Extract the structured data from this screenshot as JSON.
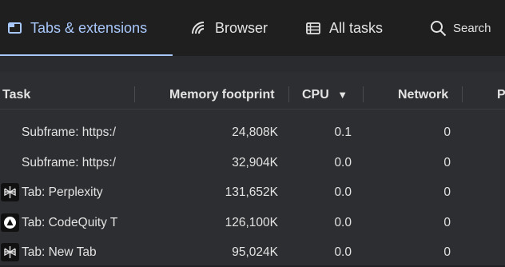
{
  "tabs": [
    {
      "label": "Tabs & extensions",
      "icon": "tabs-icon",
      "active": true
    },
    {
      "label": "Browser",
      "icon": "browser-icon",
      "active": false
    },
    {
      "label": "All tasks",
      "icon": "list-icon",
      "active": false
    }
  ],
  "search": {
    "label": "Search",
    "icon": "search-icon"
  },
  "columns": {
    "task": "Task",
    "memory": "Memory footprint",
    "cpu": "CPU",
    "sort_indicator": "▼",
    "network": "Network",
    "next": "P"
  },
  "rows": [
    {
      "task": "Subframe: https:/",
      "memory": "24,808K",
      "cpu": "0.1",
      "network": "0",
      "icon": ""
    },
    {
      "task": "Subframe: https:/",
      "memory": "32,904K",
      "cpu": "0.0",
      "network": "0",
      "icon": ""
    },
    {
      "task": "Tab: Perplexity",
      "memory": "131,652K",
      "cpu": "0.0",
      "network": "0",
      "icon": "perplexity-icon"
    },
    {
      "task": "Tab: CodeQuity T",
      "memory": "126,100K",
      "cpu": "0.0",
      "network": "0",
      "icon": "codequity-icon"
    },
    {
      "task": "Tab: New Tab",
      "memory": "95,024K",
      "cpu": "0.0",
      "network": "0",
      "icon": "perplexity-icon"
    }
  ],
  "colors": {
    "accent": "#a8c7fa",
    "background": "#202124",
    "panel": "#2d2e31"
  }
}
